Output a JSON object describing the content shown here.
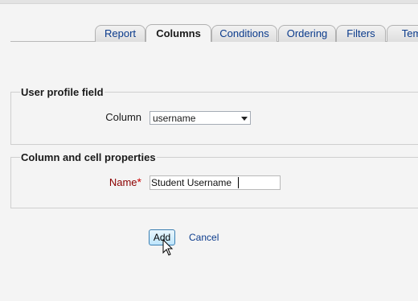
{
  "tabs": [
    {
      "label": "Report",
      "active": false
    },
    {
      "label": "Columns",
      "active": true
    },
    {
      "label": "Conditions",
      "active": false
    },
    {
      "label": "Ordering",
      "active": false
    },
    {
      "label": "Filters",
      "active": false
    },
    {
      "label": "Tem",
      "active": false
    }
  ],
  "profile_section": {
    "legend": "User profile field",
    "column_label": "Column",
    "column_value": "username"
  },
  "props_section": {
    "legend": "Column and cell properties",
    "name_label": "Name",
    "required_marker": "*",
    "name_value": "Student Username"
  },
  "actions": {
    "add_label": "Add",
    "cancel_label": "Cancel"
  },
  "colors": {
    "link": "#0b3b8c",
    "required": "#8b0000",
    "button_border": "#3c7fb1"
  }
}
